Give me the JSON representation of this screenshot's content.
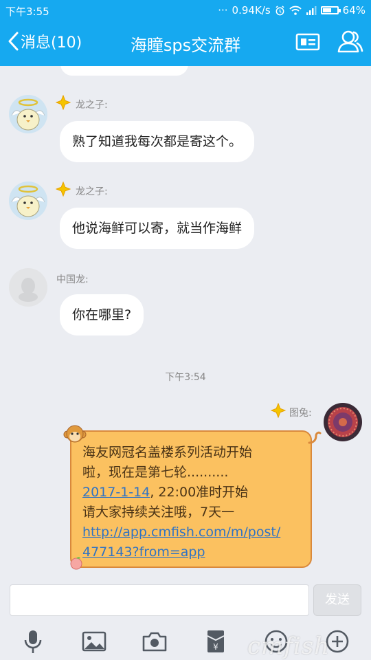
{
  "status_bar": {
    "time": "下午3:55",
    "dots": "···",
    "network_speed": "0.94K/s",
    "battery_percent": "64%",
    "battery_level": 0.64
  },
  "nav": {
    "back_label": "消息(10)",
    "title": "海瞳sps交流群"
  },
  "messages": [
    {
      "sender": "龙之子:",
      "text": "熟了知道我每次都是寄这个。"
    },
    {
      "sender": "龙之子:",
      "text": "他说海鲜可以寄，就当作海鲜"
    },
    {
      "sender": "中国龙:",
      "text": "你在哪里?"
    }
  ],
  "timestamp": "下午3:54",
  "outgoing": {
    "sender": "图兔:",
    "line1": "海友网冠名盖楼系列活动开始",
    "line2": "啦，现在是第七轮..........",
    "date_link": "2017-1-14",
    "line3_rest": ", 22:00准时开始",
    "line4": "请大家持续关注哦，7天一",
    "url_part1": "http://app.cmfish.com/m/post/",
    "url_part2": "477143?from=app"
  },
  "input": {
    "placeholder": "",
    "send_label": "发送"
  },
  "toolbar_icons": [
    "microphone-icon",
    "image-icon",
    "camera-icon",
    "red-packet-icon",
    "emoji-icon",
    "plus-icon"
  ],
  "watermark": "cmfish",
  "colors": {
    "brand_blue": "#16a9f0",
    "chat_bg": "#ebedf2",
    "orange_bubble": "#fbc160",
    "link": "#2f73c4"
  }
}
